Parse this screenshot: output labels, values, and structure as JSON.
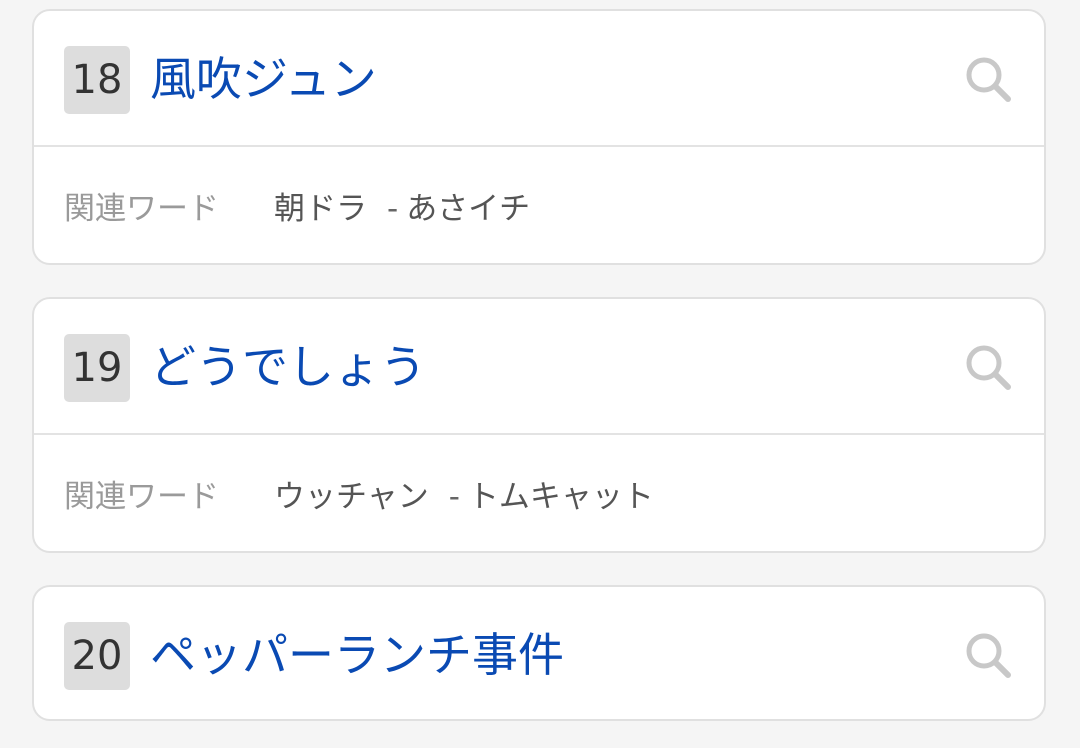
{
  "items": [
    {
      "rank": "18",
      "term": "風吹ジュン",
      "related_label": "関連ワード",
      "related": [
        "朝ドラ",
        "あさイチ"
      ],
      "separator": "-"
    },
    {
      "rank": "19",
      "term": "どうでしょう",
      "related_label": "関連ワード",
      "related": [
        "ウッチャン",
        "トムキャット"
      ],
      "separator": "-"
    },
    {
      "rank": "20",
      "term": "ペッパーランチ事件"
    }
  ],
  "icons": {
    "search": "search-icon"
  },
  "colors": {
    "term": "#0a4ab3",
    "rank_bg": "#dddddd"
  }
}
